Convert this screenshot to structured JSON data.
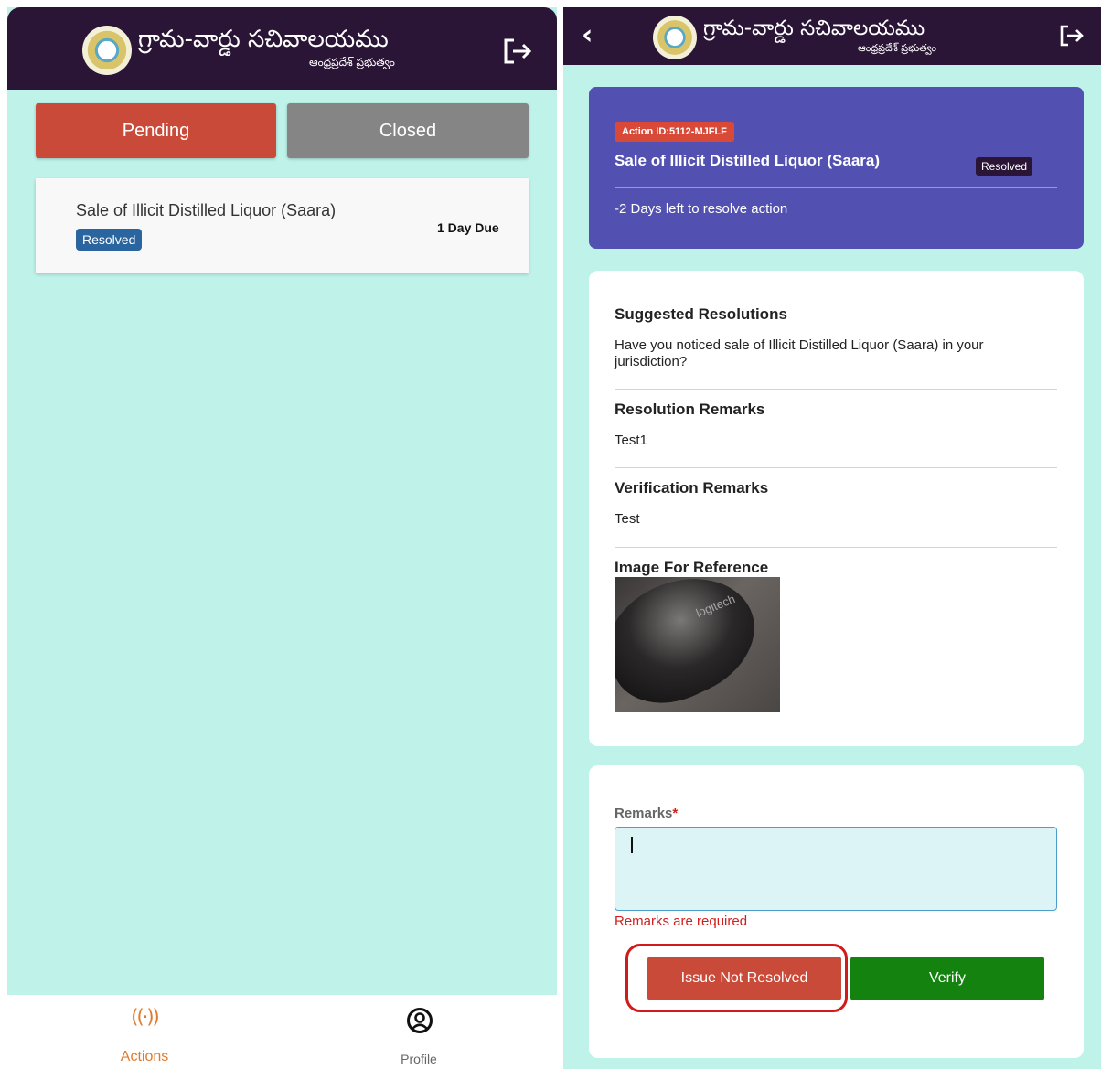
{
  "header": {
    "brand_title": "గ్రామ-వార్డు సచివాలయము",
    "brand_subtitle": "ఆంధ్రప్రదేశ్ ప్రభుత్వం"
  },
  "left": {
    "tabs": [
      {
        "label": "Pending",
        "active": true,
        "color": "#c94a39"
      },
      {
        "label": "Closed",
        "active": false,
        "color": "#858585"
      }
    ],
    "action_item": {
      "title": "Sale of Illicit Distilled Liquor (Saara)",
      "status": "Resolved",
      "due": "1 Day Due"
    },
    "bottom_nav": [
      {
        "label": "Actions",
        "icon": "broadcast-icon",
        "active": true,
        "color": "#e07a2e"
      },
      {
        "label": "Profile",
        "icon": "profile-icon",
        "active": false
      }
    ]
  },
  "detail": {
    "action_id": "Action ID:5112-MJFLF",
    "title": "Sale of Illicit Distilled Liquor (Saara)",
    "status": "Resolved",
    "days_left": "-2 Days left to resolve action",
    "sections": [
      {
        "heading": "Suggested Resolutions",
        "body": "Have you noticed sale of Illicit Distilled Liquor (Saara) in your jurisdiction?"
      },
      {
        "heading": "Resolution Remarks",
        "body": "Test1"
      },
      {
        "heading": "Verification Remarks",
        "body": "Test"
      }
    ],
    "image_heading": "Image For Reference",
    "image_text": "logitech"
  },
  "remarks_form": {
    "label": "Remarks",
    "required_mark": "*",
    "value": "",
    "error": "Remarks are required",
    "not_resolved_label": "Issue Not Resolved",
    "verify_label": "Verify"
  },
  "colors": {
    "app_bar": "#2b1536",
    "background": "#bff3ea",
    "detail_card": "#5250b0",
    "pending": "#c94a39",
    "verify": "#13820f",
    "error": "#d01f1f",
    "highlight": "#d21a1a"
  }
}
